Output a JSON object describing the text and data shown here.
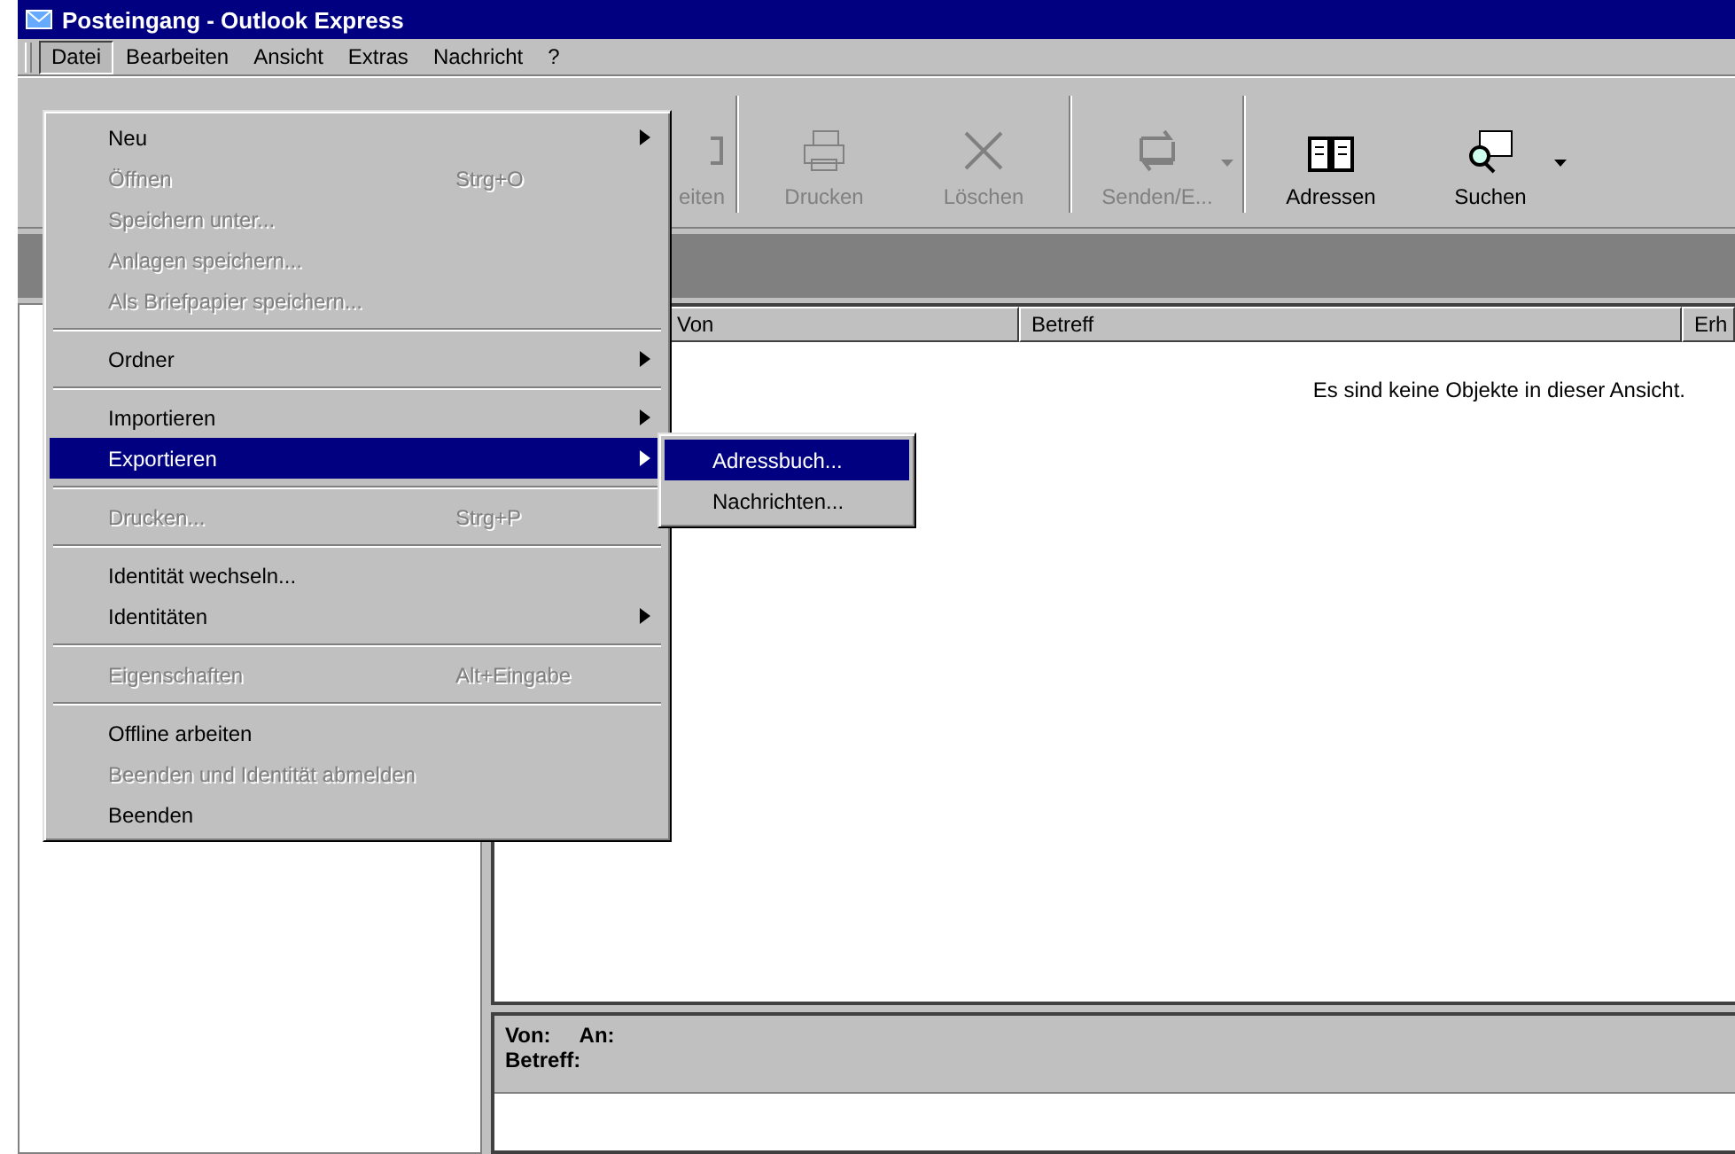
{
  "window": {
    "title": "Posteingang - Outlook Express"
  },
  "menubar": [
    {
      "label": "Datei",
      "selected": true
    },
    {
      "label": "Bearbeiten",
      "selected": false
    },
    {
      "label": "Ansicht",
      "selected": false
    },
    {
      "label": "Extras",
      "selected": false
    },
    {
      "label": "Nachricht",
      "selected": false
    },
    {
      "label": "?",
      "selected": false
    }
  ],
  "toolbar": [
    {
      "kind": "button",
      "label": "eiten",
      "disabled": true
    },
    {
      "kind": "separator"
    },
    {
      "kind": "button",
      "label": "Drucken",
      "disabled": true
    },
    {
      "kind": "button",
      "label": "Löschen",
      "disabled": true
    },
    {
      "kind": "separator"
    },
    {
      "kind": "button",
      "label": "Senden/E...",
      "disabled": true,
      "dropdown": true
    },
    {
      "kind": "separator"
    },
    {
      "kind": "button",
      "label": "Adressen",
      "disabled": false
    },
    {
      "kind": "button",
      "label": "Suchen",
      "disabled": false,
      "dropdown": true
    }
  ],
  "message_list": {
    "columns": [
      "Von",
      "Betreff",
      "Erh"
    ],
    "empty_text": "Es sind keine Objekte in dieser Ansicht."
  },
  "preview": {
    "from_label": "Von:",
    "to_label": "An:",
    "subject_label": "Betreff:"
  },
  "file_menu": {
    "items": [
      {
        "kind": "item",
        "label": "Neu",
        "disabled": false,
        "submenu": true,
        "selected": false
      },
      {
        "kind": "item",
        "label": "Öffnen",
        "shortcut": "Strg+O",
        "disabled": true,
        "submenu": false,
        "selected": false
      },
      {
        "kind": "item",
        "label": "Speichern unter...",
        "disabled": true,
        "submenu": false,
        "selected": false
      },
      {
        "kind": "item",
        "label": "Anlagen speichern...",
        "disabled": true,
        "submenu": false,
        "selected": false
      },
      {
        "kind": "item",
        "label": "Als Briefpapier speichern...",
        "disabled": true,
        "submenu": false,
        "selected": false
      },
      {
        "kind": "separator"
      },
      {
        "kind": "item",
        "label": "Ordner",
        "disabled": false,
        "submenu": true,
        "selected": false
      },
      {
        "kind": "separator"
      },
      {
        "kind": "item",
        "label": "Importieren",
        "disabled": false,
        "submenu": true,
        "selected": false
      },
      {
        "kind": "item",
        "label": "Exportieren",
        "disabled": false,
        "submenu": true,
        "selected": true
      },
      {
        "kind": "separator"
      },
      {
        "kind": "item",
        "label": "Drucken...",
        "shortcut": "Strg+P",
        "disabled": true,
        "submenu": false,
        "selected": false
      },
      {
        "kind": "separator"
      },
      {
        "kind": "item",
        "label": "Identität wechseln...",
        "disabled": false,
        "submenu": false,
        "selected": false
      },
      {
        "kind": "item",
        "label": "Identitäten",
        "disabled": false,
        "submenu": true,
        "selected": false
      },
      {
        "kind": "separator"
      },
      {
        "kind": "item",
        "label": "Eigenschaften",
        "shortcut": "Alt+Eingabe",
        "disabled": true,
        "submenu": false,
        "selected": false
      },
      {
        "kind": "separator"
      },
      {
        "kind": "item",
        "label": "Offline arbeiten",
        "disabled": false,
        "submenu": false,
        "selected": false
      },
      {
        "kind": "item",
        "label": "Beenden und Identität abmelden",
        "disabled": true,
        "submenu": false,
        "selected": false
      },
      {
        "kind": "item",
        "label": "Beenden",
        "disabled": false,
        "submenu": false,
        "selected": false
      }
    ]
  },
  "export_submenu": {
    "items": [
      {
        "label": "Adressbuch...",
        "selected": true
      },
      {
        "label": "Nachrichten...",
        "selected": false
      }
    ]
  }
}
